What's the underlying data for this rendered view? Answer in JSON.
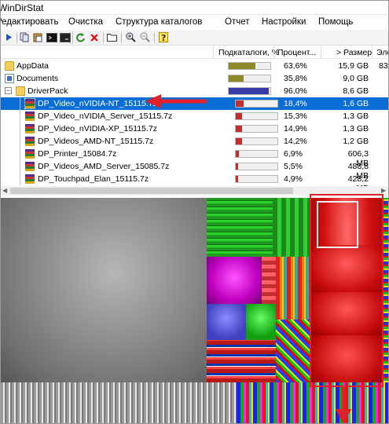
{
  "window": {
    "title": "WinDirStat"
  },
  "menu": [
    "Редактировать",
    "Очистка",
    "Структура каталогов",
    "Отчет",
    "Настройки",
    "Помощь"
  ],
  "toolbar": {
    "icons": [
      "play-icon",
      "copy-icon",
      "paste-icon",
      "terminal-icon",
      "refresh-icon",
      "recycle-icon",
      "delete-icon",
      "folder-icon",
      "zoom-in-icon",
      "zoom-out-icon",
      "help-icon"
    ]
  },
  "columns": {
    "subdirs": "Подкаталоги, %",
    "percent": "Процент...",
    "size": "> Размер",
    "items": "Эле"
  },
  "rows": [
    {
      "name": "AppData",
      "bar_fraction": 0.636,
      "bar_color": "#8e8a2c",
      "percent": "63,6%",
      "size": "15,9 GB",
      "items": "83"
    },
    {
      "name": "Documents",
      "bar_fraction": 0.358,
      "bar_color": "#8e8a2c",
      "percent": "35,8%",
      "size": "9,0 GB",
      "items": ""
    },
    {
      "name": "DriverPack",
      "bar_fraction": 0.96,
      "bar_color": "#3a3aa6",
      "percent": "96,0%",
      "size": "8,6 GB",
      "items": ""
    },
    {
      "name": "DP_Video_nVIDIA-NT_15115.7z",
      "bar_fraction": 0.184,
      "bar_color": "#c03030",
      "percent": "18,4%",
      "size": "1,6 GB",
      "items": ""
    },
    {
      "name": "DP_Video_nVIDIA_Server_15115.7z",
      "bar_fraction": 0.153,
      "bar_color": "#c03030",
      "percent": "15,3%",
      "size": "1,3 GB",
      "items": ""
    },
    {
      "name": "DP_Video_nVIDIA-XP_15115.7z",
      "bar_fraction": 0.149,
      "bar_color": "#c03030",
      "percent": "14,9%",
      "size": "1,3 GB",
      "items": ""
    },
    {
      "name": "DP_Videos_AMD-NT_15115.7z",
      "bar_fraction": 0.142,
      "bar_color": "#c03030",
      "percent": "14,2%",
      "size": "1,2 GB",
      "items": ""
    },
    {
      "name": "DP_Printer_15084.7z",
      "bar_fraction": 0.069,
      "bar_color": "#c03030",
      "percent": "6,9%",
      "size": "606,3 MB",
      "items": ""
    },
    {
      "name": "DP_Videos_AMD_Server_15085.7z",
      "bar_fraction": 0.055,
      "bar_color": "#c03030",
      "percent": "5,5%",
      "size": "488,8 MB",
      "items": ""
    },
    {
      "name": "DP_Touchpad_Elan_15115.7z",
      "bar_fraction": 0.049,
      "bar_color": "#c03030",
      "percent": "4,9%",
      "size": "428,2 MB",
      "items": ""
    }
  ]
}
